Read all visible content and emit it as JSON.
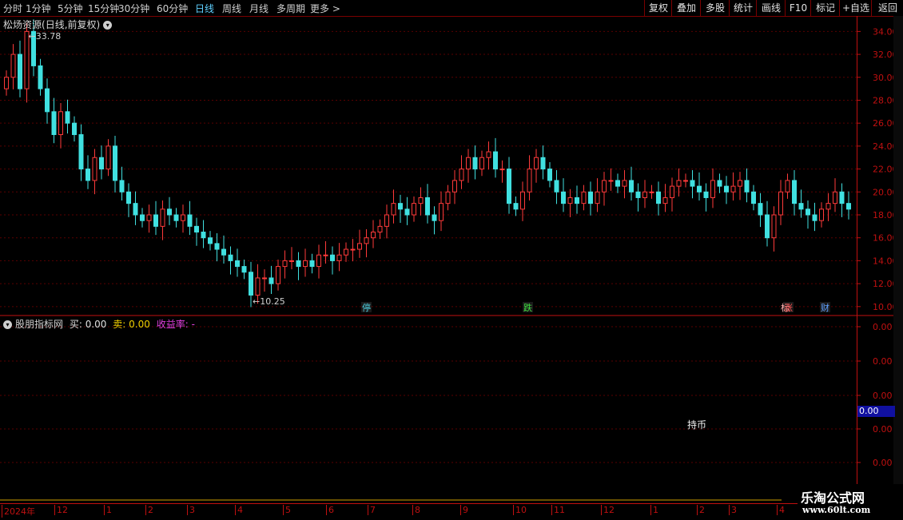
{
  "toolbar": {
    "periods": [
      "分时",
      "1分钟",
      "5分钟",
      "15分钟",
      "30分钟",
      "60分钟",
      "日线",
      "周线",
      "月线",
      "多周期",
      "更多"
    ],
    "active_period": "日线",
    "more_arrow": ">",
    "actions": [
      "复权",
      "叠加",
      "多股",
      "统计",
      "画线",
      "F10",
      "标记",
      "+自选",
      "返回"
    ]
  },
  "main_panel": {
    "stock_name": "松炀资源",
    "mode": "(日线,前复权)",
    "dropdown_icon": "chevron-down-icon",
    "high_label": "33.78",
    "low_label": "10.25"
  },
  "indicator_panel": {
    "name": "股朋指标网",
    "buy_label": "买:",
    "buy_value": "0.00",
    "sell_label": "卖:",
    "sell_value": "0.00",
    "return_label": "收益率:",
    "return_value": "-",
    "holding_label": "持币",
    "value_tag": "0.00",
    "scale_ticks": [
      "0.00",
      "0.00",
      "0.00",
      "0.00",
      "0.00"
    ]
  },
  "event_markers": [
    {
      "text": "停",
      "color": "#4fd0e0",
      "date_index": "Jul"
    },
    {
      "text": "跌",
      "color": "#40e040",
      "date_index": "Oct"
    },
    {
      "text": "涨",
      "color": "#ff5050",
      "prefix": "标",
      "date_index": "Mar"
    },
    {
      "text": "财",
      "color": "#60a0ff",
      "date_index": "Apr"
    }
  ],
  "brand": {
    "name": "乐淘公式网",
    "url": "www.60lt.com"
  },
  "colors": {
    "up": "#ff3a3a",
    "down": "#40e0e0",
    "grid": "#5a0000",
    "axis": "#c01010",
    "text": "#d0d0d0"
  },
  "chart_data": {
    "type": "candlestick",
    "title": "松炀资源(日线,前复权)",
    "ylim": [
      9.5,
      35
    ],
    "y_ticks": [
      10,
      12,
      14,
      16,
      18,
      20,
      22,
      24,
      26,
      28,
      30,
      32,
      34
    ],
    "x_labels": [
      "2024年",
      "12",
      "1",
      "2",
      "3",
      "4",
      "5",
      "6",
      "7",
      "8",
      "9",
      "10",
      "11",
      "12",
      "1",
      "2",
      "3",
      "4"
    ],
    "annotations": [
      {
        "text": "33.78",
        "type": "high"
      },
      {
        "text": "10.25",
        "type": "low"
      }
    ],
    "close_path": [
      30,
      32,
      29,
      34,
      31,
      29,
      27,
      25,
      27,
      26,
      25,
      22,
      21,
      23,
      22,
      24,
      21,
      20,
      19,
      18,
      17.5,
      18,
      17,
      18.5,
      18,
      17.5,
      18,
      17,
      16.5,
      16,
      15.5,
      15,
      14.5,
      14,
      13.5,
      13,
      11,
      12.5,
      12.5,
      12,
      13.5,
      14,
      14,
      13.5,
      14,
      13.5,
      14.5,
      14.5,
      14,
      14.5,
      15,
      15,
      15.5,
      16,
      16.5,
      17,
      18,
      19,
      18.5,
      18,
      19,
      19.5,
      18,
      17.5,
      19,
      20,
      21,
      22,
      23,
      22,
      23,
      23.5,
      22,
      22,
      19,
      18.5,
      20,
      22,
      23,
      22,
      21,
      20,
      19,
      19.5,
      19,
      20,
      19,
      20,
      21,
      21,
      20.5,
      21,
      20,
      19.5,
      20,
      20,
      19,
      19.5,
      20.5,
      21,
      21,
      20.5,
      20,
      19.5,
      21,
      20.5,
      20,
      20.5,
      21,
      20,
      19,
      18,
      16,
      18,
      20,
      21,
      19,
      18.5,
      18,
      17.5,
      18.5,
      19,
      20,
      19,
      18.5
    ]
  }
}
